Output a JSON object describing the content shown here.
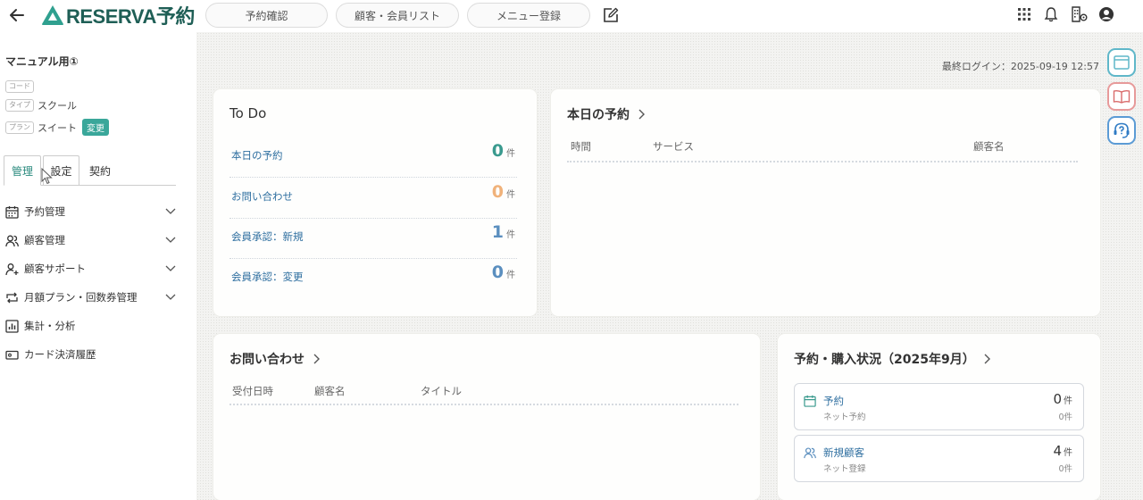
{
  "header": {
    "logo_text": "RESERVA予約",
    "nav": [
      "予約確認",
      "顧客・会員リスト",
      "メニュー登録"
    ]
  },
  "sidebar": {
    "org_name": "マニュアル用①",
    "code_tag": "コード",
    "type_tag": "タイプ",
    "type_value": "スクール",
    "plan_tag": "プラン",
    "plan_value": "スイート",
    "change_label": "変更",
    "tabs": [
      "管理",
      "設定",
      "契約"
    ],
    "menu": [
      {
        "label": "予約管理",
        "icon": "calendar-icon",
        "expandable": true
      },
      {
        "label": "顧客管理",
        "icon": "users-icon",
        "expandable": true
      },
      {
        "label": "顧客サポート",
        "icon": "user-plus-icon",
        "expandable": true
      },
      {
        "label": "月額プラン・回数券管理",
        "icon": "repeat-icon",
        "expandable": true
      },
      {
        "label": "集計・分析",
        "icon": "chart-icon",
        "expandable": false
      },
      {
        "label": "カード決済履歴",
        "icon": "card-icon",
        "expandable": false
      }
    ]
  },
  "main": {
    "last_login": "最終ログイン：2025-09-19 12:57",
    "todo": {
      "title": "To Do",
      "rows": [
        {
          "label": "本日の予約",
          "value": "0",
          "unit": "件",
          "color": "#3a9a8e"
        },
        {
          "label": "お問い合わせ",
          "value": "0",
          "unit": "件",
          "color": "#f0b27a"
        },
        {
          "label": "会員承認：新規",
          "value": "1",
          "unit": "件",
          "color": "#5b8fbf"
        },
        {
          "label": "会員承認：変更",
          "value": "0",
          "unit": "件",
          "color": "#5b8fbf"
        }
      ]
    },
    "today": {
      "title": "本日の予約",
      "columns": [
        "時間",
        "サービス",
        "顧客名"
      ]
    },
    "inquiries": {
      "title": "お問い合わせ",
      "columns": [
        "受付日時",
        "顧客名",
        "タイトル"
      ]
    },
    "status": {
      "title": "予約・購入状況（2025年9月）",
      "items": [
        {
          "label": "予約",
          "sub": "ネット予約",
          "value": "0",
          "unit": "件",
          "subvalue": "0件",
          "icon": "calendar-icon"
        },
        {
          "label": "新規顧客",
          "sub": "ネット登録",
          "value": "4",
          "unit": "件",
          "subvalue": "0件",
          "icon": "users-icon"
        }
      ]
    }
  },
  "colors": {
    "brand": "#1f5f56",
    "accent": "#3aa79a",
    "link": "#2f6fa0"
  }
}
